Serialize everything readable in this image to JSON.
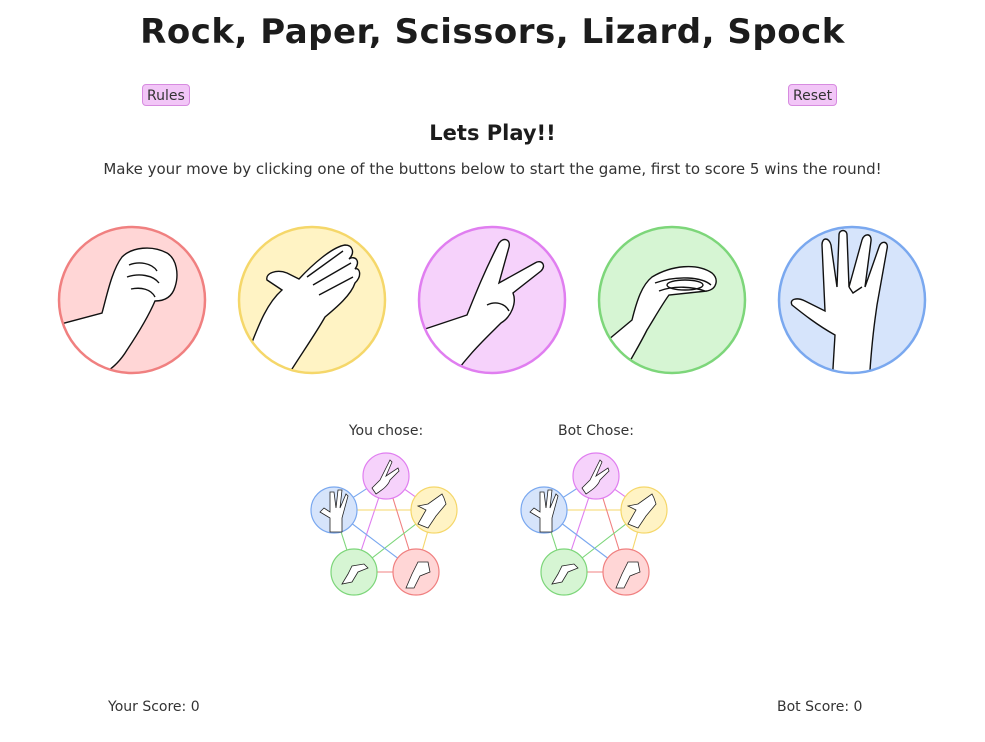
{
  "header": {
    "title": "Rock, Paper, Scissors, Lizard, Spock",
    "rules_label": "Rules",
    "reset_label": "Reset"
  },
  "intro": {
    "heading": "Lets Play!!",
    "instructions": "Make your move by clicking one of the buttons below to start the game, first to score 5 wins the round!"
  },
  "moves": [
    {
      "id": "rock",
      "icon": "rock-hand-icon",
      "fill": "#ffd6d6",
      "stroke": "#f08080"
    },
    {
      "id": "paper",
      "icon": "paper-hand-icon",
      "fill": "#fff3c4",
      "stroke": "#f5d76a"
    },
    {
      "id": "scissors",
      "icon": "scissors-hand-icon",
      "fill": "#f6d2fb",
      "stroke": "#e07ef0"
    },
    {
      "id": "lizard",
      "icon": "lizard-hand-icon",
      "fill": "#d6f5d3",
      "stroke": "#7dd67a"
    },
    {
      "id": "spock",
      "icon": "spock-hand-icon",
      "fill": "#d6e4fb",
      "stroke": "#7aa8ef"
    }
  ],
  "result": {
    "you_label": "You chose:",
    "bot_label": "Bot Chose:"
  },
  "scores": {
    "you": "Your Score: 0",
    "bot": "Bot Score: 0"
  }
}
